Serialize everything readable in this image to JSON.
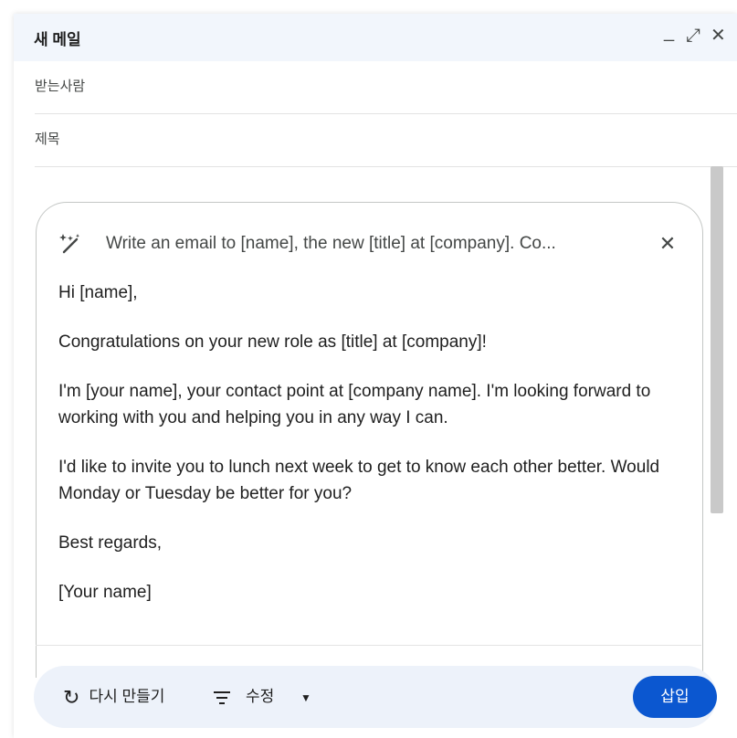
{
  "window": {
    "title": "새 메일",
    "minimize_label": "_",
    "expand_label": "⤢",
    "close_label": "✕"
  },
  "fields": {
    "to_label": "받는사람",
    "to_value": "",
    "subject_label": "제목",
    "subject_value": ""
  },
  "ai_panel": {
    "icon": "magic-wand-icon",
    "prompt_text": "Write an email to [name], the new [title] at [company]. Co...",
    "close_label": "✕",
    "draft_paragraphs": [
      "Hi [name],",
      "Congratulations on your new role as [title] at [company]!",
      "I'm [your name], your contact point at [company name]. I'm looking forward to working with you and helping you in any way I can.",
      "I'd like to invite you to lunch next week to get to know each other better. Would Monday or Tuesday be better for you?",
      "Best regards,",
      "[Your name]"
    ]
  },
  "toolbar": {
    "regenerate_icon": "refresh-icon",
    "regenerate_label": "다시 만들기",
    "refine_icon": "filter-lines-icon",
    "refine_label": "수정",
    "refine_dropdown_icon": "caret-down-icon",
    "insert_label": "삽입"
  },
  "colors": {
    "title_bar_bg": "#f2f6fc",
    "toolbar_bg": "#edf2fa",
    "primary_button": "#0b57d0"
  }
}
